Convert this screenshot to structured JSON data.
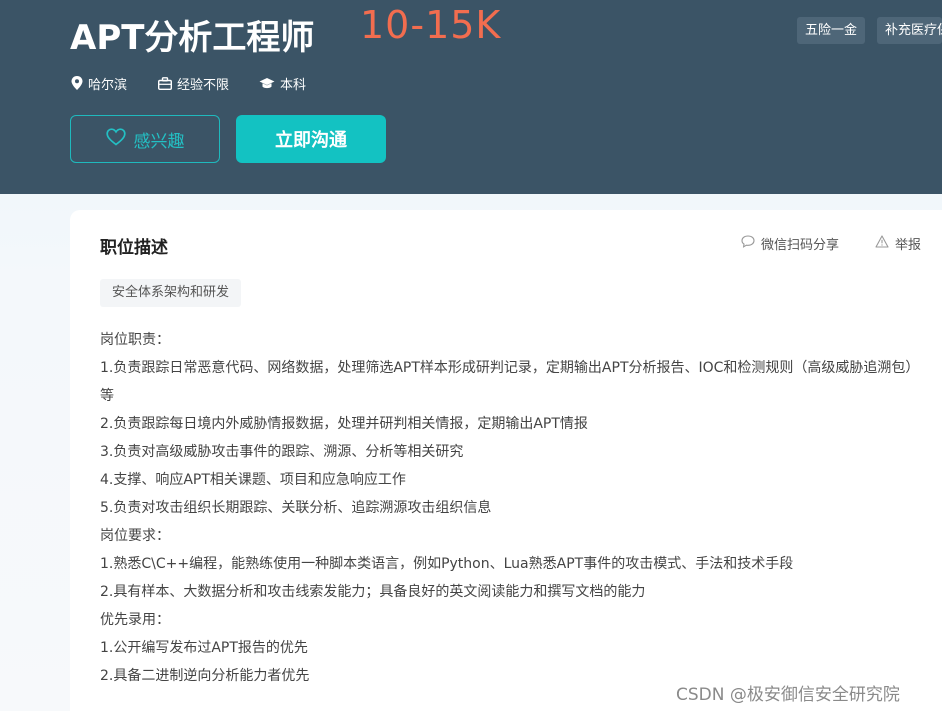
{
  "job": {
    "title": "APT分析工程师",
    "salary": "10-15K",
    "benefits": [
      "五险一金",
      "补充医疗保险"
    ],
    "meta": {
      "location": "哈尔滨",
      "experience": "经验不限",
      "education": "本科"
    }
  },
  "buttons": {
    "interest_label": "感兴趣",
    "chat_label": "立即沟通"
  },
  "section": {
    "title": "职位描述",
    "share_label": "微信扫码分享",
    "report_label": "举报",
    "category_tag": "安全体系架构和研发"
  },
  "description": {
    "lines": [
      "岗位职责：",
      "1.负责跟踪日常恶意代码、网络数据，处理筛选APT样本形成研判记录，定期输出APT分析报告、IOC和检测规则（高级威胁追溯包）等",
      "2.负责跟踪每日境内外威胁情报数据，处理并研判相关情报，定期输出APT情报",
      "3.负责对高级威胁攻击事件的跟踪、溯源、分析等相关研究",
      "4.支撑、响应APT相关课题、项目和应急响应工作",
      "5.负责对攻击组织长期跟踪、关联分析、追踪溯源攻击组织信息",
      "岗位要求：",
      "1.熟悉C\\C++编程，能熟练使用一种脚本类语言，例如Python、Lua熟悉APT事件的攻击模式、手法和技术手段",
      "2.具有样本、大数据分析和攻击线索发能力；具备良好的英文阅读能力和撰写文档的能力",
      "优先录用：",
      "1.公开编写发布过APT报告的优先",
      "2.具备二进制逆向分析能力者优先"
    ]
  },
  "watermark": "CSDN @极安御信安全研究院",
  "colors": {
    "header_bg": "#3b5466",
    "salary": "#f26d4f",
    "accent": "#13c2c2"
  },
  "icons": {
    "location": "location-pin-icon",
    "experience": "briefcase-icon",
    "education": "graduation-cap-icon",
    "interest": "heart-icon",
    "share": "chat-bubble-icon",
    "report": "warning-triangle-icon"
  }
}
